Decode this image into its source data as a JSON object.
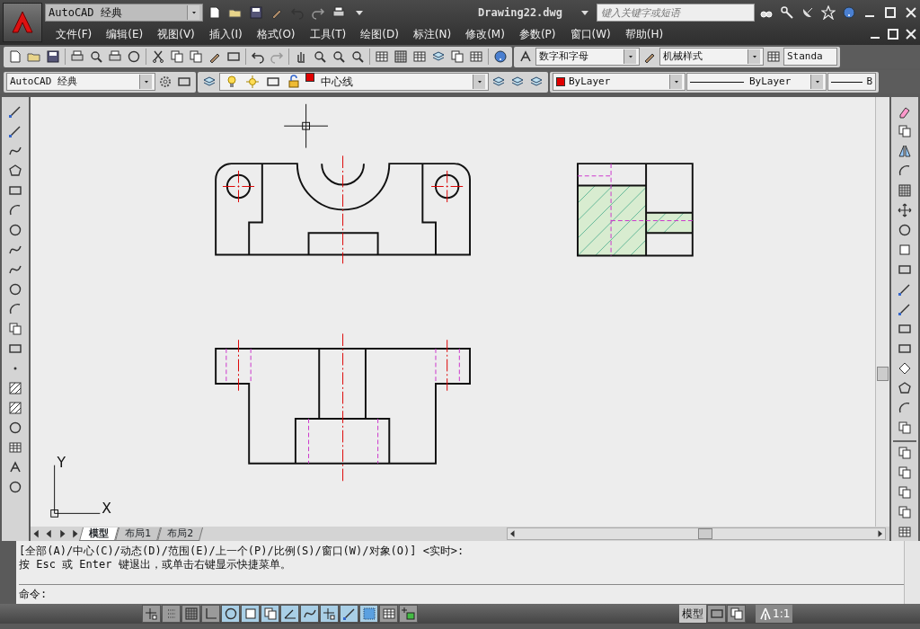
{
  "app": {
    "workspace": "AutoCAD 经典",
    "title": "Drawing22.dwg",
    "search_placeholder": "键入关键字或短语"
  },
  "menu": [
    "文件(F)",
    "编辑(E)",
    "视图(V)",
    "插入(I)",
    "格式(O)",
    "工具(T)",
    "绘图(D)",
    "标注(N)",
    "修改(M)",
    "参数(P)",
    "窗口(W)",
    "帮助(H)"
  ],
  "styles_toolbar": {
    "text_style": "数字和字母",
    "dim_style": "机械样式",
    "table_style": "Standa"
  },
  "layers_toolbar": {
    "workspace": "AutoCAD 经典",
    "layer": {
      "name": "中心线",
      "color": "#e00000"
    },
    "color": {
      "name": "ByLayer",
      "color": "#e00000"
    },
    "linetype": "ByLayer",
    "lineweight": "B"
  },
  "canvas": {
    "ucs_y": "Y",
    "ucs_x": "X"
  },
  "tabs": [
    {
      "label": "模型",
      "selected": true
    },
    {
      "label": "布局1",
      "selected": false
    },
    {
      "label": "布局2",
      "selected": false
    }
  ],
  "command": {
    "history": [
      "[全部(A)/中心(C)/动态(D)/范围(E)/上一个(P)/比例(S)/窗口(W)/对象(O)] <实时>:",
      "按 Esc 或 Enter 键退出，或单击右键显示快捷菜单。"
    ],
    "prompt": "命令:"
  },
  "status": {
    "toggles": [
      {
        "on": false
      },
      {
        "on": false
      },
      {
        "on": false
      },
      {
        "on": false
      },
      {
        "on": true
      },
      {
        "on": true
      },
      {
        "on": true
      },
      {
        "on": true
      },
      {
        "on": true
      },
      {
        "on": true
      },
      {
        "on": true
      },
      {
        "on": true
      },
      {
        "on": false
      },
      {
        "on": false
      }
    ],
    "model": "模型",
    "scale": "1:1"
  }
}
